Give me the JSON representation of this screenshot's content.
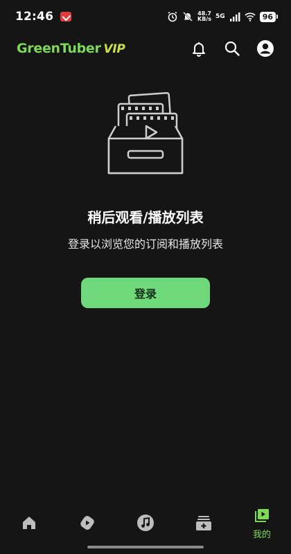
{
  "status_bar": {
    "time": "12:46",
    "net_speed_value": "48.7",
    "net_speed_unit": "KB/s",
    "network": "5G",
    "battery": "96"
  },
  "app_bar": {
    "logo_brand": "GreenTuber",
    "logo_vip": "VIP"
  },
  "empty_state": {
    "title": "稍后观看/播放列表",
    "subtitle": "登录以浏览您的订阅和播放列表",
    "login_label": "登录"
  },
  "bottom_nav": {
    "items": [
      {
        "icon": "home-icon",
        "label": ""
      },
      {
        "icon": "shorts-icon",
        "label": ""
      },
      {
        "icon": "music-icon",
        "label": ""
      },
      {
        "icon": "subscriptions-icon",
        "label": ""
      },
      {
        "icon": "library-icon",
        "label": "我的"
      }
    ]
  },
  "colors": {
    "background": "#151515",
    "accent": "#6fd87a",
    "logo_green": "#7ed957"
  }
}
